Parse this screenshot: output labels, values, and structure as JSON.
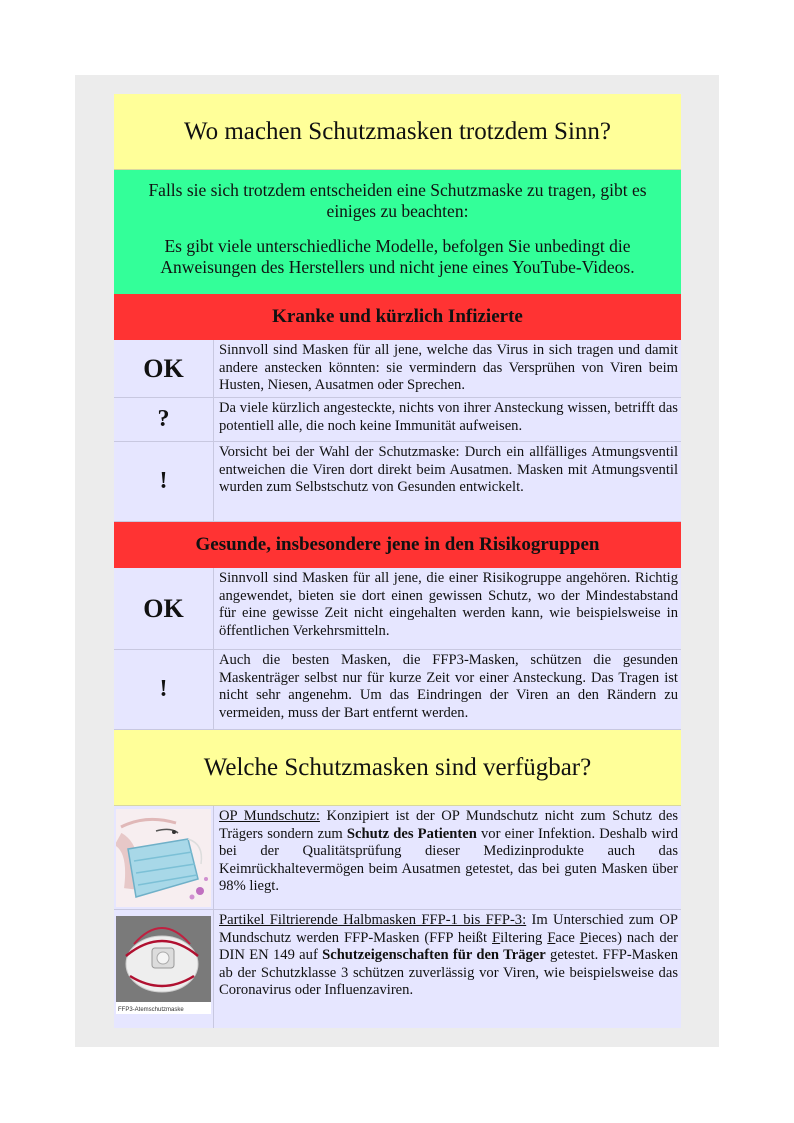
{
  "heading1": "Wo machen Schutzmasken trotzdem Sinn?",
  "intro": {
    "p1": "Falls sie sich trotzdem entscheiden eine Schutzmaske zu tragen, gibt es einiges zu beachten:",
    "p2": "Es gibt viele unterschiedliche Modelle, befolgen Sie unbedingt die Anweisungen des Herstellers und nicht jene eines YouTube-Videos."
  },
  "section1": {
    "title": "Kranke und kürzlich Infizierte",
    "rows": [
      {
        "symbol": "OK",
        "text": "Sinnvoll sind Masken für all jene, welche das Virus in sich tragen und damit andere anstecken könnten: sie vermindern das Versprühen von Viren beim Husten, Niesen, Ausatmen oder Sprechen."
      },
      {
        "symbol": "?",
        "text": "Da viele kürzlich angesteckte, nichts von ihrer Ansteckung wissen, betrifft das potentiell alle, die noch keine Immunität aufweisen."
      },
      {
        "symbol": "!",
        "text": "Vorsicht bei der Wahl der Schutzmaske: Durch ein allfälliges Atmungsventil entweichen die Viren dort direkt beim Ausatmen. Masken mit Atmungsventil wurden zum Selbstschutz von Gesunden entwickelt."
      }
    ]
  },
  "section2": {
    "title": "Gesunde, insbesondere jene in den Risikogruppen",
    "rows": [
      {
        "symbol": "OK",
        "text": "Sinnvoll sind Masken für all jene, die einer Risikogruppe angehören. Richtig angewendet, bieten sie dort einen gewissen Schutz, wo der Mindestabstand für eine gewisse Zeit nicht eingehalten werden kann, wie beispielsweise in öffentlichen Verkehrsmitteln."
      },
      {
        "symbol": "!",
        "text": "Auch die besten Masken, die FFP3-Masken, schützen die gesunden Maskenträger selbst nur für kurze Zeit vor einer Ansteckung. Das Tragen ist nicht sehr angenehm. Um das Eindringen der Viren an den Rändern zu vermeiden, muss der Bart entfernt werden."
      }
    ]
  },
  "heading2": "Welche Schutzmasken sind verfügbar?",
  "masks": {
    "op": {
      "label": "OP Mundschutz:",
      "text1": " Konzipiert ist der OP Mundschutz nicht zum Schutz des Trägers sondern zum ",
      "bold": "Schutz des Patienten",
      "text2": " vor einer Infektion. Deshalb wird bei der Qualitätsprüfung dieser Medizinprodukte auch das Keimrückhaltevermögen beim Ausatmen getestet, das bei guten Masken über 98% liegt."
    },
    "ffp": {
      "label": "Partikel Filtrierende Halbmasken FFP-1 bis FFP-3:",
      "text1": " Im Unterschied zum OP Mundschutz werden FFP-Masken (FFP heißt ",
      "f1": "F",
      "t_f1": "iltering ",
      "f2": "F",
      "t_f2": "ace ",
      "f3": "P",
      "t_f3": "ieces",
      "text2": ") nach der DIN EN 149 auf ",
      "bold": "Schutzeigenschaften für den Träger",
      "text3": " getestet. FFP-Masken ab der Schutzklasse 3 schützen zuverlässig vor Viren, wie beispielsweise das Coronavirus  oder Influenzaviren.",
      "image_caption": "FFP3-Atemschutzmaske"
    }
  }
}
